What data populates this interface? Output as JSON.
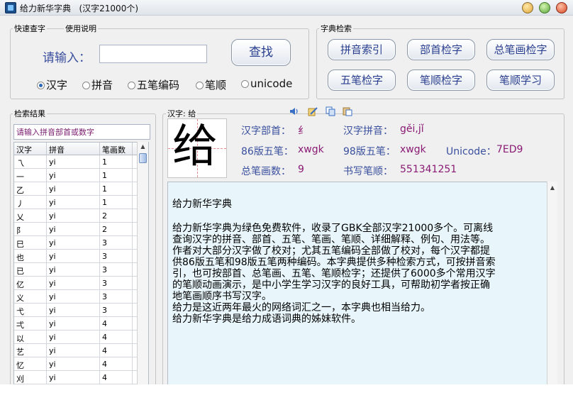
{
  "window": {
    "title": "给力新华字典",
    "subtitle": "(汉字21000个)"
  },
  "quick": {
    "tab_search": "快速查字",
    "tab_help": "使用说明",
    "prompt": "请输入：",
    "input_value": "",
    "search_button": "查找",
    "radio_options": [
      "汉字",
      "拼音",
      "五笔编码",
      "笔顺",
      "unicode"
    ],
    "selected_radio": "汉字"
  },
  "dict": {
    "legend": "字典检索",
    "buttons": [
      "拼音索引",
      "部首检字",
      "总笔画检字",
      "五笔检字",
      "笔顺检字",
      "笔顺学习"
    ]
  },
  "results": {
    "legend": "检索结果",
    "filter_placeholder": "请输入拼音部首或数字",
    "columns": [
      "汉字",
      "拼音",
      "笔画数"
    ],
    "rows": [
      [
        "乁",
        "yi",
        "1"
      ],
      [
        "一",
        "yi",
        "1"
      ],
      [
        "乙",
        "yi",
        "1"
      ],
      [
        "丿",
        "yi",
        "1"
      ],
      [
        "乂",
        "yi",
        "2"
      ],
      [
        "阝",
        "yi",
        "2"
      ],
      [
        "巳",
        "yi",
        "3"
      ],
      [
        "也",
        "yi",
        "3"
      ],
      [
        "已",
        "yi",
        "3"
      ],
      [
        "亿",
        "yi",
        "3"
      ],
      [
        "义",
        "yi",
        "3"
      ],
      [
        "弋",
        "yi",
        "3"
      ],
      [
        "弌",
        "yi",
        "4"
      ],
      [
        "以",
        "yi",
        "4"
      ],
      [
        "艺",
        "yi",
        "4"
      ],
      [
        "忆",
        "yi",
        "4"
      ],
      [
        "刈",
        "yi",
        "4"
      ]
    ]
  },
  "detail": {
    "header_label": "汉字: 给",
    "character": "给",
    "radical_label": "汉字部首：",
    "radical_value": "纟",
    "pinyin_label": "汉字拼音：",
    "pinyin_value": "gěi,jǐ",
    "wubi86_label": "86版五笔：",
    "wubi86_value": "xwgk",
    "wubi98_label": "98版五笔：",
    "wubi98_value": "xwgk",
    "unicode_label": "Unicode：",
    "unicode_value": "7ED9",
    "strokes_label": "总笔画数：",
    "strokes_value": "9",
    "order_label": "书写笔顺：",
    "order_value": "551341251",
    "icons": [
      "speaker-icon",
      "edit-icon",
      "copy-icon",
      "paste-icon"
    ]
  },
  "description": {
    "title": "给力新华字典",
    "lines": [
      "给力新华字典为绿色免费软件，收录了GBK全部汉字21000多个。可离线",
      "查询汉字的拼音、部首、五笔、笔画、笔顺、详细解释、例句、用法等。",
      "作者对大部分汉字做了校对；尤其五笔编码全部做了校对，每个汉字都提",
      "供86版五笔和98版五笔两种编码。本字典提供多种检索方式，可按拼音索",
      "引，也可按部首、总笔画、五笔、笔顺检字；还提供了6000多个常用汉字",
      "的笔顺动画演示，是中小学生学习汉字的良好工具，可帮助初学者按正确",
      "地笔画顺序书写汉字。",
      "给力是这近两年最火的网络词汇之一，本字典也相当给力。",
      "给力新华字典是给力成语词典的姊妹软件。"
    ]
  },
  "colors": {
    "label_blue": "#3a4f9e",
    "value_purple": "#8a1a74",
    "desc_bg": "#e8f6fb"
  }
}
